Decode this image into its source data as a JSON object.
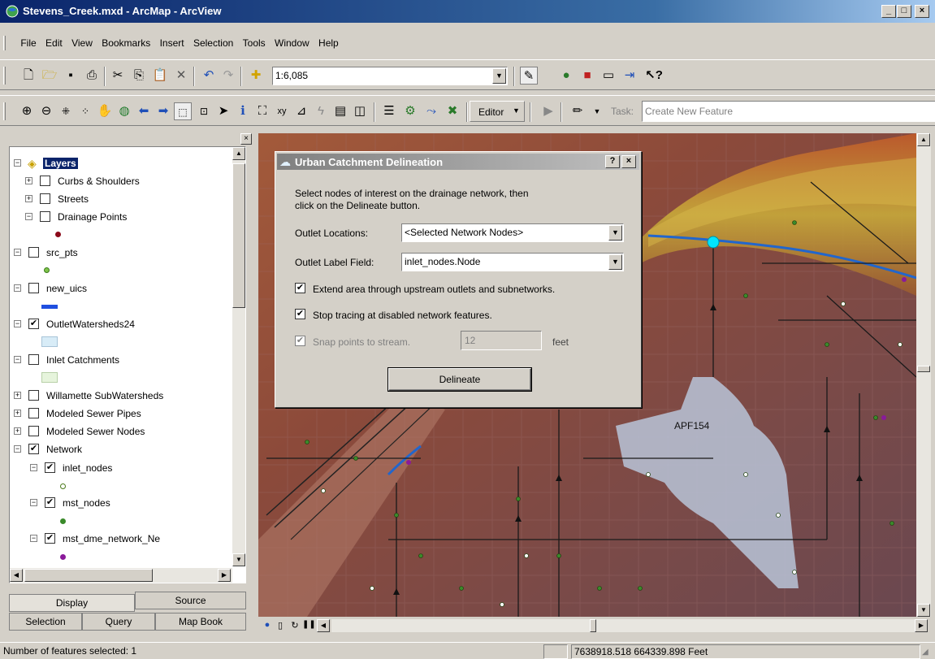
{
  "window": {
    "title": "Stevens_Creek.mxd - ArcMap - ArcView",
    "min": "_",
    "max": "□",
    "close": "×"
  },
  "menu": [
    "File",
    "Edit",
    "View",
    "Bookmarks",
    "Insert",
    "Selection",
    "Tools",
    "Window",
    "Help"
  ],
  "standard_toolbar": {
    "scale": "1:6,085"
  },
  "tools_toolbar": {
    "editor_label": "Editor",
    "task_label": "Task:",
    "task_value": "Create New Feature"
  },
  "toc": {
    "root": "Layers",
    "layers": [
      {
        "label": "Curbs & Shoulders",
        "checked": false,
        "expander": "+"
      },
      {
        "label": "Streets",
        "checked": false,
        "expander": "+"
      },
      {
        "label": "Drainage Points",
        "checked": false,
        "expander": "−"
      },
      {
        "label": "src_pts",
        "checked": false,
        "expander": "−"
      },
      {
        "label": "new_uics",
        "checked": false,
        "expander": "−"
      },
      {
        "label": "OutletWatersheds24",
        "checked": true,
        "expander": "−"
      },
      {
        "label": "Inlet Catchments",
        "checked": false,
        "expander": "−"
      },
      {
        "label": "Willamette SubWatersheds",
        "checked": false,
        "expander": "+"
      },
      {
        "label": "Modeled Sewer Pipes",
        "checked": false,
        "expander": "+"
      },
      {
        "label": "Modeled Sewer Nodes",
        "checked": false,
        "expander": "+"
      },
      {
        "label": "Network",
        "checked": true,
        "expander": "−"
      },
      {
        "label": "inlet_nodes",
        "checked": true,
        "expander": "−"
      },
      {
        "label": "mst_nodes",
        "checked": true,
        "expander": "−"
      },
      {
        "label": "mst_dme_network_Ne",
        "checked": true,
        "expander": "−"
      }
    ],
    "tabs": {
      "display": "Display",
      "source": "Source",
      "selection": "Selection",
      "query": "Query",
      "map_book": "Map Book"
    }
  },
  "dialog": {
    "title": "Urban Catchment Delineation",
    "help": "?",
    "close": "×",
    "instructions_line1": "Select nodes of interest on the drainage network, then",
    "instructions_line2": "click on the Delineate button.",
    "outlet_locations_label": "Outlet Locations:",
    "outlet_locations_value": "<Selected Network Nodes>",
    "outlet_label_field_label": "Outlet Label Field:",
    "outlet_label_field_value": "inlet_nodes.Node",
    "extend_area_label": "Extend area through upstream outlets and subnetworks.",
    "stop_tracing_label": "Stop tracing at disabled network features.",
    "snap_points_label": "Snap points to stream.",
    "snap_value": "12",
    "snap_unit": "feet",
    "delineate_button": "Delineate"
  },
  "map": {
    "label": "APF154"
  },
  "status": {
    "selected_text": "Number of features selected: 1",
    "coords": "7638918.518  664339.898 Feet"
  },
  "colors": {
    "title_bar": "#0a246a",
    "watershed_fill": "#b8c4d8",
    "stream": "#2266cc",
    "node_selected": "#00e5ff"
  }
}
